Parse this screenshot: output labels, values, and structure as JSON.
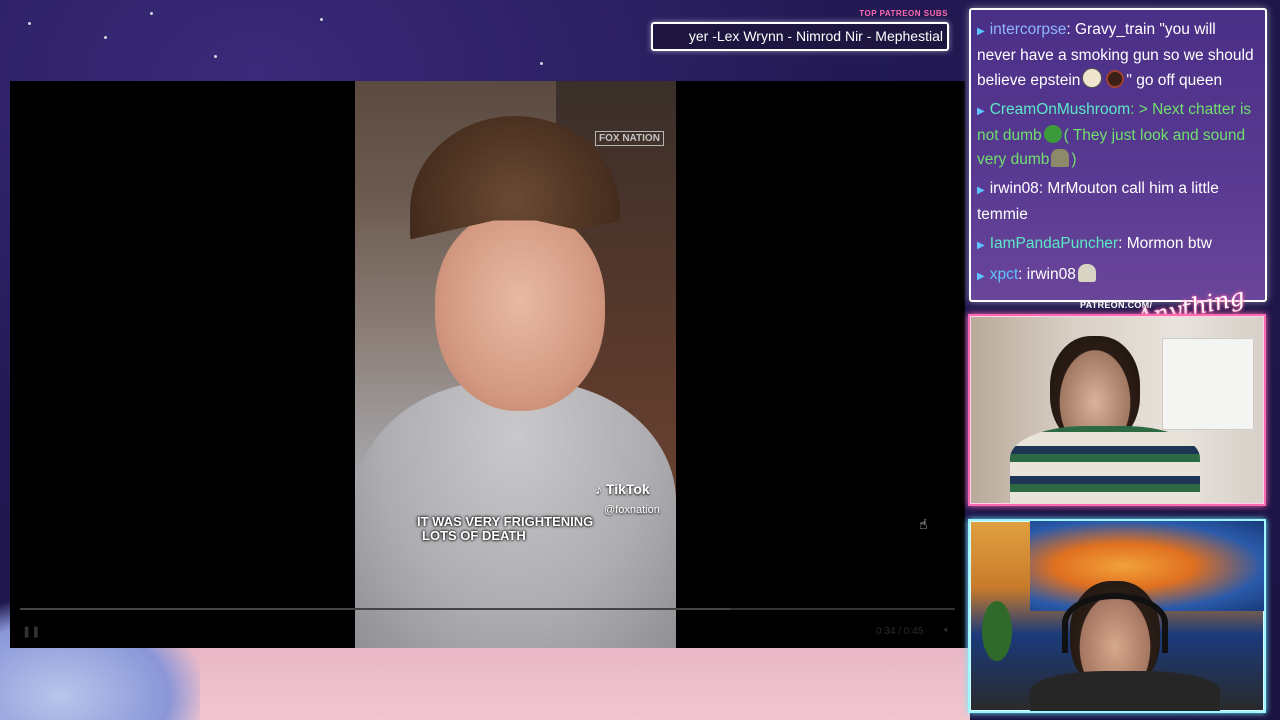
{
  "ticker": {
    "label": "TOP PATREON SUBS",
    "text": "yer -Lex Wrynn - Nimrod Nir - Mephestial"
  },
  "video": {
    "watermark": "FOX NATION",
    "tiktok_brand": "TikTok",
    "tiktok_handle": "@foxnation",
    "caption_line1": "IT WAS VERY FRIGHTENING",
    "caption_line2": "LOTS OF DEATH",
    "time": "0:34 / 0:45",
    "progress": 0.76
  },
  "chat": {
    "messages": [
      {
        "user": "intercorpse",
        "user_color": "#8fb6ff",
        "text": ": Gravy_train \"you will never have a smoking gun so we should believe epstein",
        "emotes_after": [
          "face",
          "dark"
        ],
        "tail": "\" go off queen",
        "green": false
      },
      {
        "user": "CreamOnMushroom",
        "user_color": "#5ce8c8",
        "text": ": > Next chatter is not dumb",
        "mid_emote": "frog",
        "text2": "( They just look and sound very dumb",
        "end_emote": "hat",
        "tail": ")",
        "green": true
      },
      {
        "user": "irwin08",
        "user_color": "#ffffff",
        "text": ": MrMouton call him a little temmie",
        "green": false
      },
      {
        "user": "IamPandaPuncher",
        "user_color": "#5ce8c8",
        "text": ": Mormon btw",
        "green": false
      },
      {
        "user": "xpct",
        "user_color": "#5ec4ff",
        "text": ": irwin08",
        "end_emote": "ghost",
        "green": false
      }
    ]
  },
  "branding": {
    "patreon_url": "PATREON.COM/",
    "logo_text": "Anything Else?"
  },
  "colors": {
    "ticker_label": "#ff6ab1",
    "cam1_border": "#ff6ab1",
    "cam2_border": "#9ef7ff",
    "greentext": "#6fe06b"
  }
}
